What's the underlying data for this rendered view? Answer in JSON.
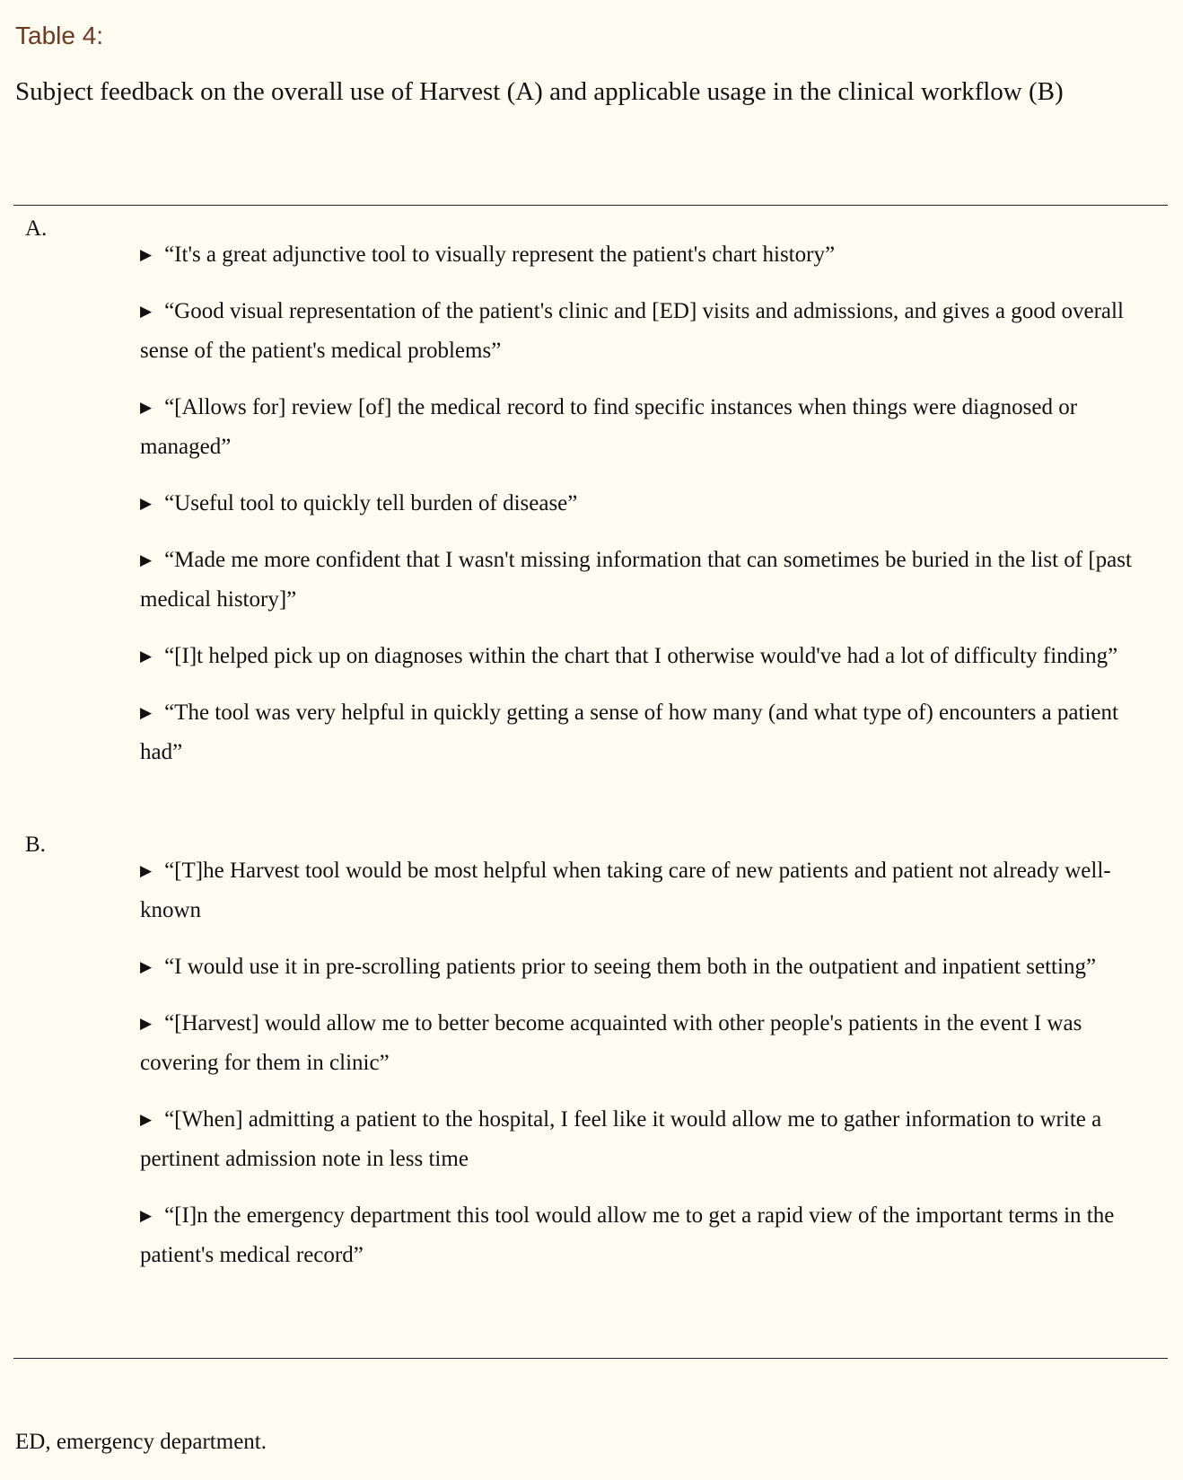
{
  "table_label": "Table 4:",
  "caption": "Subject feedback on the overall use of Harvest (A) and applicable usage in the clinical workflow (B)",
  "bullet_glyph": "▶",
  "sections": [
    {
      "label": "A.",
      "items": [
        "“It's a great adjunctive tool to visually represent the patient's chart history”",
        "“Good visual representation of the patient's clinic and [ED] visits and admissions, and gives a good overall sense of the patient's medical problems”",
        "“[Allows for] review [of] the medical record to find specific instances when things were diagnosed or managed”",
        "“Useful tool to quickly tell burden of disease”",
        "“Made me more confident that I wasn't missing information that can sometimes be buried in the list of [past medical history]”",
        "“[I]t helped pick up on diagnoses within the chart that I otherwise would've had a lot of difficulty finding”",
        "“The tool was very helpful in quickly getting a sense of how many (and what type of) encounters a patient had”"
      ]
    },
    {
      "label": "B.",
      "items": [
        "“[T]he Harvest tool would be most helpful when taking care of new patients and patient not already well-known",
        "“I would use it in pre-scrolling patients prior to seeing them both in the outpatient and inpatient setting”",
        "“[Harvest] would allow me to better become acquainted with other people's patients in the event I was covering for them in clinic”",
        "“[When] admitting a patient to the hospital, I feel like it would allow me to gather information to write a pertinent admission note in less time",
        "“[I]n the emergency department this tool would allow me to get a rapid view of the important terms in the patient's medical record”"
      ]
    }
  ],
  "footnote": "ED, emergency department."
}
